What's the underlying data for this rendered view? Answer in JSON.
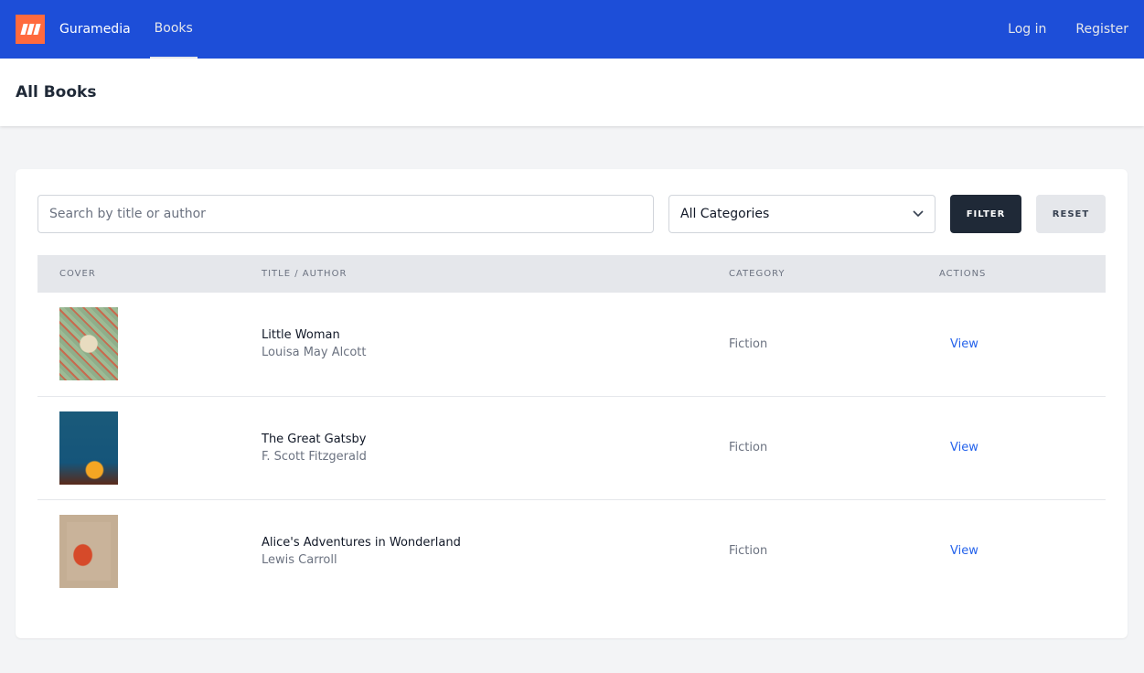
{
  "nav": {
    "brand": "Guramedia",
    "books": "Books",
    "login": "Log in",
    "register": "Register"
  },
  "header": {
    "title": "All Books"
  },
  "filters": {
    "search_placeholder": "Search by title or author",
    "category": "All Categories",
    "filter_label": "FILTER",
    "reset_label": "RESET"
  },
  "table": {
    "headers": [
      "COVER",
      "TITLE / AUTHOR",
      "CATEGORY",
      "ACTIONS"
    ],
    "rows": [
      {
        "title": "Little Woman",
        "author": "Louisa May Alcott",
        "category": "Fiction",
        "action": "View"
      },
      {
        "title": "The Great Gatsby",
        "author": "F. Scott Fitzgerald",
        "category": "Fiction",
        "action": "View"
      },
      {
        "title": "Alice's Adventures in Wonderland",
        "author": "Lewis Carroll",
        "category": "Fiction",
        "action": "View"
      }
    ]
  },
  "colors": {
    "nav": "#1d4ed8",
    "logo": "#ff6a3d",
    "filter_button": "#1f2937",
    "link": "#2563eb"
  }
}
